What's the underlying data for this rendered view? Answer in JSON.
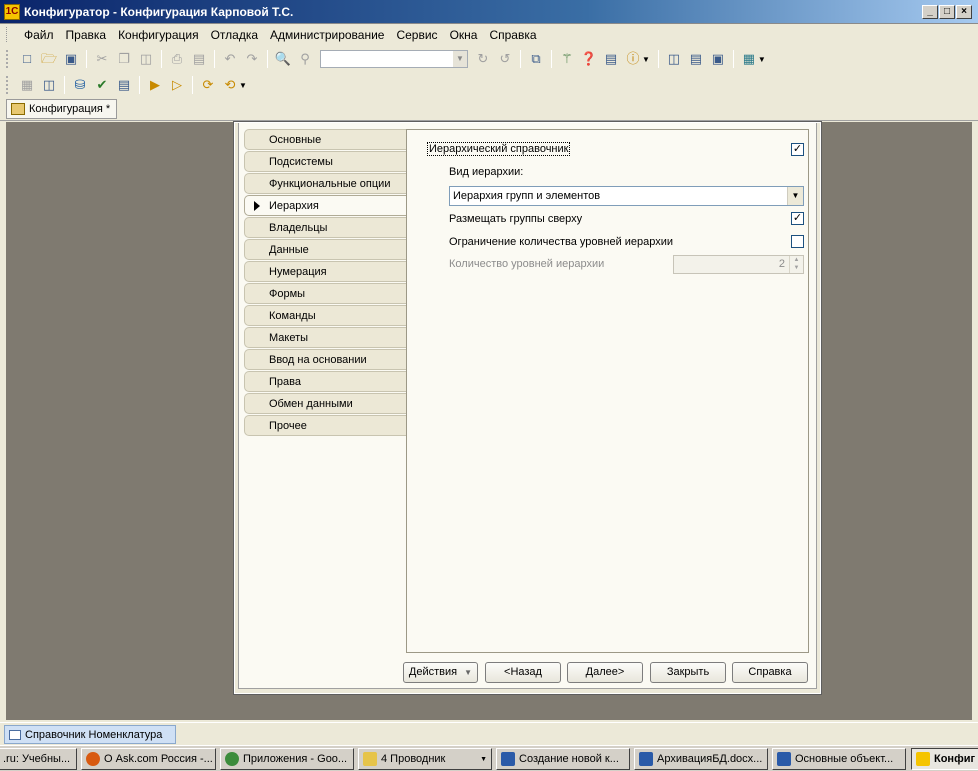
{
  "window": {
    "title": "Конфигуратор - Конфигурация Карповой Т.С.",
    "min_glyph": "_",
    "max_glyph": "□",
    "close_glyph": "×"
  },
  "menu": [
    "Файл",
    "Правка",
    "Конфигурация",
    "Отладка",
    "Администрирование",
    "Сервис",
    "Окна",
    "Справка"
  ],
  "toolbar": {
    "search_combo_value": ""
  },
  "window_tab": {
    "label": "Конфигурация *"
  },
  "dialog": {
    "tabs": [
      "Основные",
      "Подсистемы",
      "Функциональные опции",
      "Иерархия",
      "Владельцы",
      "Данные",
      "Нумерация",
      "Формы",
      "Команды",
      "Макеты",
      "Ввод на основании",
      "Права",
      "Обмен данными",
      "Прочее"
    ],
    "active_tab": "Иерархия",
    "hierarchy": {
      "hierarchical_label": "Иерархический справочник",
      "hierarchical_checked": true,
      "kind_label": "Вид иерархии:",
      "kind_value": "Иерархия групп и элементов",
      "groups_top_label": "Размещать группы сверху",
      "groups_top_checked": true,
      "limit_levels_label": "Ограничение количества уровней иерархии",
      "limit_levels_checked": false,
      "levels_count_label": "Количество уровней иерархии",
      "levels_count_value": "2"
    },
    "buttons": {
      "actions": "Действия",
      "back": "<Назад",
      "next": "Далее>",
      "close": "Закрыть",
      "help": "Справка"
    }
  },
  "panel": {
    "open_window": "Справочник Номенклатура"
  },
  "taskbar": [
    {
      "label": ".ru: Учебны...",
      "icon_color": "#e0a020"
    },
    {
      "label": "О Ask.com Россия -...",
      "icon_color": "#d85a10"
    },
    {
      "label": "Приложения - Goo...",
      "icon_color": "#3c8c3c"
    },
    {
      "label": "4 Проводник",
      "icon_color": "#e6c44a"
    },
    {
      "label": "Создание новой к...",
      "icon_color": "#2a5aa8"
    },
    {
      "label": "АрхивацияБД.docx...",
      "icon_color": "#2a5aa8"
    },
    {
      "label": "Основные объект...",
      "icon_color": "#2a5aa8"
    },
    {
      "label": "Конфиг",
      "icon_color": "#f5c400"
    }
  ]
}
